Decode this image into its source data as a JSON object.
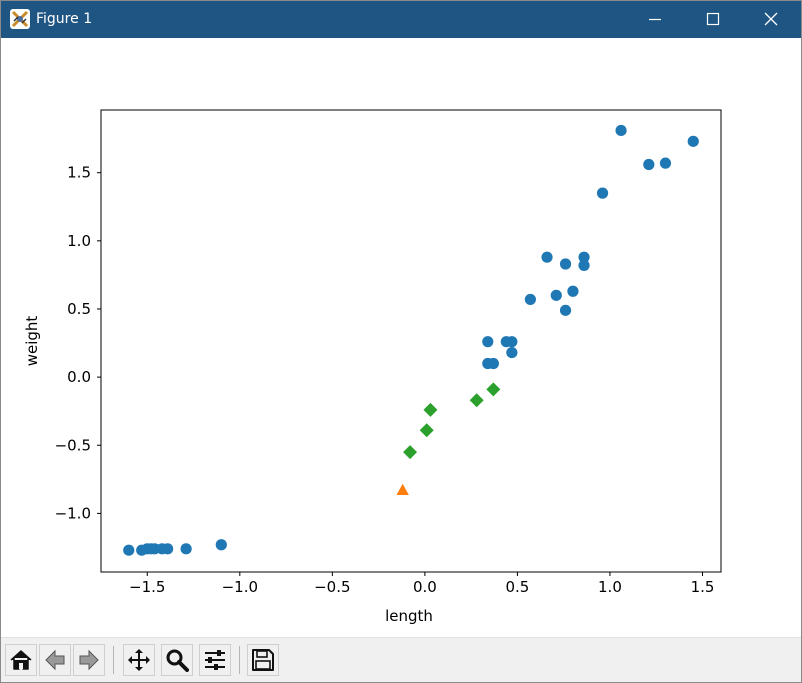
{
  "window": {
    "title": "Figure 1"
  },
  "toolbar": {
    "buttons": [
      "home-icon",
      "back-icon",
      "forward-icon",
      "pan-icon",
      "zoom-icon",
      "configure-subplots-icon",
      "save-icon"
    ]
  },
  "chart_data": {
    "type": "scatter",
    "xlabel": "length",
    "ylabel": "weight",
    "xlim": [
      -1.75,
      1.6
    ],
    "ylim": [
      -1.43,
      1.96
    ],
    "xticks": [
      -1.5,
      -1.0,
      -0.5,
      0.0,
      0.5,
      1.0,
      1.5
    ],
    "xtick_labels": [
      "−1.5",
      "−1.0",
      "−0.5",
      "0.0",
      "0.5",
      "1.0",
      "1.5"
    ],
    "yticks": [
      -1.0,
      -0.5,
      0.0,
      0.5,
      1.0,
      1.5
    ],
    "ytick_labels": [
      "−1.0",
      "−0.5",
      "0.0",
      "0.5",
      "1.0",
      "1.5"
    ],
    "grid": false,
    "series": [
      {
        "marker": "circle",
        "color": "#1f77b4",
        "points": [
          [
            -1.6,
            -1.27
          ],
          [
            -1.53,
            -1.27
          ],
          [
            -1.5,
            -1.26
          ],
          [
            -1.48,
            -1.26
          ],
          [
            -1.46,
            -1.26
          ],
          [
            -1.42,
            -1.26
          ],
          [
            -1.39,
            -1.26
          ],
          [
            -1.29,
            -1.26
          ],
          [
            -1.1,
            -1.23
          ],
          [
            0.34,
            0.26
          ],
          [
            0.34,
            0.1
          ],
          [
            0.37,
            0.1
          ],
          [
            0.44,
            0.26
          ],
          [
            0.47,
            0.26
          ],
          [
            0.47,
            0.18
          ],
          [
            0.57,
            0.57
          ],
          [
            0.66,
            0.88
          ],
          [
            0.71,
            0.6
          ],
          [
            0.76,
            0.83
          ],
          [
            0.76,
            0.49
          ],
          [
            0.8,
            0.63
          ],
          [
            0.86,
            0.88
          ],
          [
            0.86,
            0.82
          ],
          [
            0.96,
            1.35
          ],
          [
            1.06,
            1.81
          ],
          [
            1.21,
            1.56
          ],
          [
            1.3,
            1.57
          ],
          [
            1.45,
            1.73
          ]
        ]
      },
      {
        "marker": "triangle",
        "color": "#ff7f0e",
        "points": [
          [
            -0.12,
            -0.83
          ]
        ]
      },
      {
        "marker": "diamond",
        "color": "#2ca02c",
        "points": [
          [
            -0.08,
            -0.55
          ],
          [
            0.01,
            -0.39
          ],
          [
            0.03,
            -0.24
          ],
          [
            0.28,
            -0.17
          ],
          [
            0.37,
            -0.09
          ]
        ]
      }
    ]
  }
}
